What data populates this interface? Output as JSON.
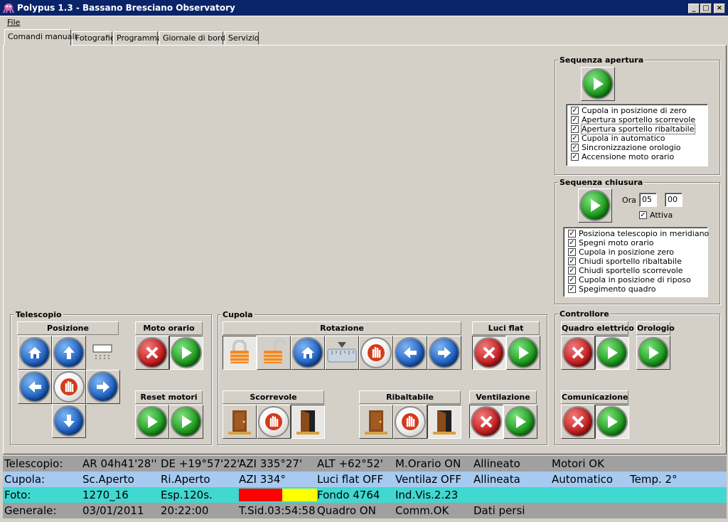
{
  "window": {
    "title": "Polypus 1.3 - Bassano Bresciano Observatory",
    "buttons": [
      "_",
      "□",
      "×"
    ]
  },
  "menu": {
    "file": "File"
  },
  "tabs": [
    "Comandi manuali",
    "Fotografie",
    "Programma",
    "Giornale di bordo",
    "Servizio"
  ],
  "telescopio": {
    "title": "Telescopio",
    "posizione": "Posizione",
    "moto_orario": "Moto orario",
    "reset_motori": "Reset motori"
  },
  "cupola": {
    "title": "Cupola",
    "rotazione": "Rotazione",
    "luci_flat": "Luci flat",
    "scorrevole": "Scorrevole",
    "ribaltabile": "Ribaltabile",
    "ventilazione": "Ventilazione"
  },
  "controllore": {
    "title": "Controllore",
    "quadro": "Quadro elettrico",
    "orologio": "Orologio",
    "comunicazione": "Comunicazione"
  },
  "apertura": {
    "title": "Sequenza apertura",
    "items": [
      "Cupola in posizione di zero",
      "Apertura sportello scorrevole",
      "Apertura sportello ribaltabile",
      "Cupola in automatico",
      "Sincronizzazione orologio",
      "Accensione moto orario"
    ]
  },
  "chiusura": {
    "title": "Sequenza chiusura",
    "ora_label": "Ora",
    "ora_h": "05",
    "ora_m": "00",
    "attiva": "Attiva",
    "items": [
      "Posiziona telescopio in meridiano",
      "Spegni moto orario",
      "Cupola in posizione zero",
      "Chiudi sportello ribaltabile",
      "Chiudi sportello scorrevole",
      "Cupola in posizione di riposo",
      "Spegimento quadro"
    ]
  },
  "status": {
    "telescopio": [
      "Telescopio:",
      "AR 04h41'28''",
      "DE +19°57'22''",
      "AZI 335°27'",
      "ALT +62°52'",
      "M.Orario ON",
      "Allineato",
      "Motori OK"
    ],
    "cupola": [
      "Cupola:",
      "Sc.Aperto",
      "Ri.Aperto",
      "AZI 334°",
      "Luci flat OFF",
      "Ventilaz OFF",
      "Allineata",
      "Automatico",
      "Temp. 2°"
    ],
    "foto": [
      "Foto:",
      "1270_16",
      "Esp.120s.",
      "Fondo 4764",
      "Ind.Vis.2.23"
    ],
    "generale": [
      "Generale:",
      "03/01/2011",
      "20:22:00",
      "T.Sid.03:54:58",
      "Quadro ON",
      "Comm.OK",
      "Dati persi"
    ]
  },
  "colors": {
    "titlebar": "#0a246a",
    "row_telescopio": "#a0a0a0",
    "row_cupola": "#a6caf0",
    "row_foto": "#40d8d0",
    "row_generale": "#a0a0a0",
    "progress_red": "#ff0000",
    "progress_yellow": "#ffff00"
  },
  "foto_progress": 0.55
}
